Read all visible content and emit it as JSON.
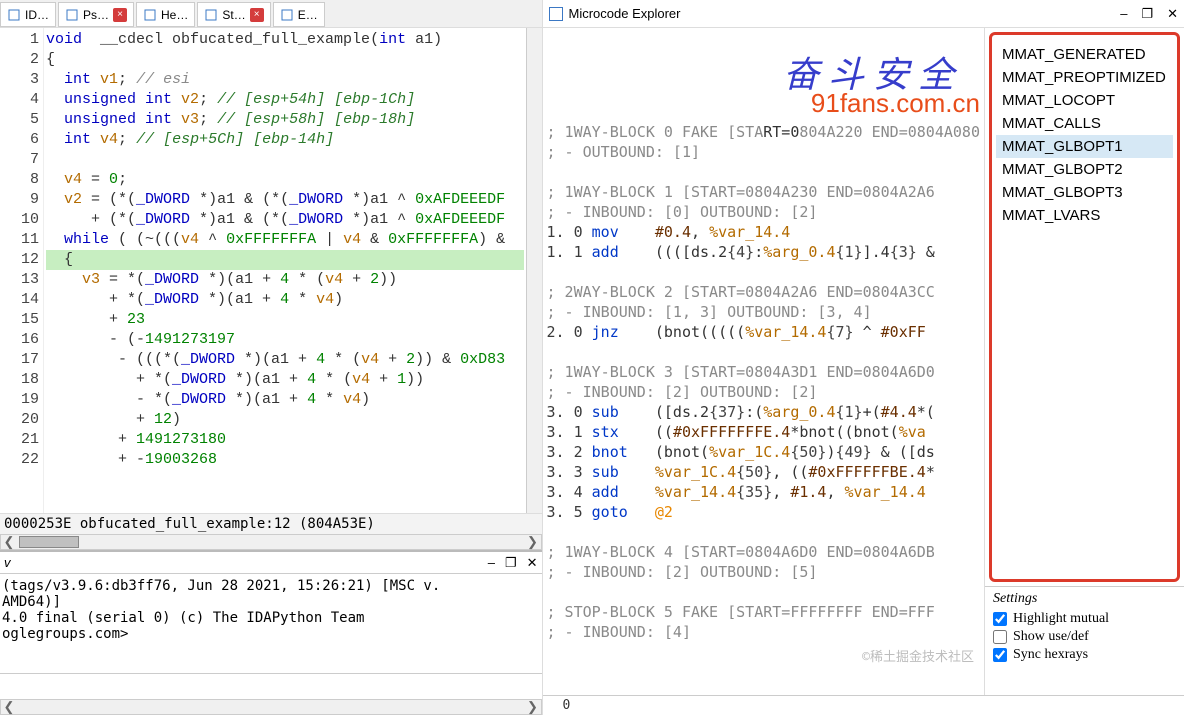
{
  "tabs": [
    {
      "icon": "doc",
      "label": "ID…"
    },
    {
      "icon": "doc",
      "label": "Ps…",
      "close": true
    },
    {
      "icon": "hex",
      "label": "He…"
    },
    {
      "icon": "struct",
      "label": "St…",
      "close": true
    },
    {
      "icon": "enum",
      "label": "E…"
    }
  ],
  "breakpoints": [
    8,
    9,
    10,
    11,
    13
  ],
  "code": [
    {
      "n": 1,
      "t": [
        [
          "kw",
          "void"
        ],
        [
          "op",
          "  __cdecl obfucated_full_example("
        ],
        [
          "kw",
          "int"
        ],
        [
          "op",
          " a1)"
        ]
      ]
    },
    {
      "n": 2,
      "t": [
        [
          "op",
          "{"
        ]
      ]
    },
    {
      "n": 3,
      "t": [
        [
          "op",
          "  "
        ],
        [
          "kw",
          "int"
        ],
        [
          "var",
          " v1"
        ],
        [
          "op",
          "; "
        ],
        [
          "cmt",
          "// esi"
        ]
      ]
    },
    {
      "n": 4,
      "t": [
        [
          "op",
          "  "
        ],
        [
          "kw",
          "unsigned int"
        ],
        [
          "var",
          " v2"
        ],
        [
          "op",
          "; "
        ],
        [
          "cmt-r",
          "// [esp+54h] [ebp-1Ch]"
        ]
      ]
    },
    {
      "n": 5,
      "t": [
        [
          "op",
          "  "
        ],
        [
          "kw",
          "unsigned int"
        ],
        [
          "var",
          " v3"
        ],
        [
          "op",
          "; "
        ],
        [
          "cmt-r",
          "// [esp+58h] [ebp-18h]"
        ]
      ]
    },
    {
      "n": 6,
      "t": [
        [
          "op",
          "  "
        ],
        [
          "kw",
          "int"
        ],
        [
          "var",
          " v4"
        ],
        [
          "op",
          "; "
        ],
        [
          "cmt-r",
          "// [esp+5Ch] [ebp-14h]"
        ]
      ]
    },
    {
      "n": 7,
      "t": []
    },
    {
      "n": 8,
      "t": [
        [
          "op",
          "  "
        ],
        [
          "var",
          "v4"
        ],
        [
          "op",
          " = "
        ],
        [
          "num",
          "0"
        ],
        [
          "op",
          ";"
        ]
      ]
    },
    {
      "n": 9,
      "t": [
        [
          "op",
          "  "
        ],
        [
          "var",
          "v2"
        ],
        [
          "op",
          " = (*("
        ],
        [
          "kw",
          "_DWORD"
        ],
        [
          "op",
          " *)a1 & (*("
        ],
        [
          "kw",
          "_DWORD"
        ],
        [
          "op",
          " *)a1 ^ "
        ],
        [
          "num",
          "0xAFDEEEDF"
        ]
      ]
    },
    {
      "n": 10,
      "t": [
        [
          "op",
          "     + (*("
        ],
        [
          "kw",
          "_DWORD"
        ],
        [
          "op",
          " *)a1 & (*("
        ],
        [
          "kw",
          "_DWORD"
        ],
        [
          "op",
          " *)a1 ^ "
        ],
        [
          "num",
          "0xAFDEEEDF"
        ]
      ]
    },
    {
      "n": 11,
      "t": [
        [
          "op",
          "  "
        ],
        [
          "kw",
          "while"
        ],
        [
          "op",
          " ( (~((("
        ],
        [
          "var",
          "v4"
        ],
        [
          "op",
          " ^ "
        ],
        [
          "num",
          "0xFFFFFFFA"
        ],
        [
          "op",
          " | "
        ],
        [
          "var",
          "v4"
        ],
        [
          "op",
          " & "
        ],
        [
          "num",
          "0xFFFFFFFA"
        ],
        [
          "op",
          ") &"
        ]
      ]
    },
    {
      "n": 12,
      "hl": true,
      "t": [
        [
          "op",
          "  {"
        ]
      ]
    },
    {
      "n": 13,
      "t": [
        [
          "op",
          "    "
        ],
        [
          "var",
          "v3"
        ],
        [
          "op",
          " = *("
        ],
        [
          "kw",
          "_DWORD"
        ],
        [
          "op",
          " *)(a1 + "
        ],
        [
          "num",
          "4"
        ],
        [
          "op",
          " * ("
        ],
        [
          "var",
          "v4"
        ],
        [
          "op",
          " + "
        ],
        [
          "num",
          "2"
        ],
        [
          "op",
          "))"
        ]
      ]
    },
    {
      "n": 14,
      "t": [
        [
          "op",
          "       + *("
        ],
        [
          "kw",
          "_DWORD"
        ],
        [
          "op",
          " *)(a1 + "
        ],
        [
          "num",
          "4"
        ],
        [
          "op",
          " * "
        ],
        [
          "var",
          "v4"
        ],
        [
          "op",
          ")"
        ]
      ]
    },
    {
      "n": 15,
      "t": [
        [
          "op",
          "       + "
        ],
        [
          "num",
          "23"
        ]
      ]
    },
    {
      "n": 16,
      "t": [
        [
          "op",
          "       - (-"
        ],
        [
          "num",
          "1491273197"
        ]
      ]
    },
    {
      "n": 17,
      "t": [
        [
          "op",
          "        - (((*("
        ],
        [
          "kw",
          "_DWORD"
        ],
        [
          "op",
          " *)(a1 + "
        ],
        [
          "num",
          "4"
        ],
        [
          "op",
          " * ("
        ],
        [
          "var",
          "v4"
        ],
        [
          "op",
          " + "
        ],
        [
          "num",
          "2"
        ],
        [
          "op",
          ")) & "
        ],
        [
          "num",
          "0xD83"
        ]
      ]
    },
    {
      "n": 18,
      "t": [
        [
          "op",
          "          + *("
        ],
        [
          "kw",
          "_DWORD"
        ],
        [
          "op",
          " *)(a1 + "
        ],
        [
          "num",
          "4"
        ],
        [
          "op",
          " * ("
        ],
        [
          "var",
          "v4"
        ],
        [
          "op",
          " + "
        ],
        [
          "num",
          "1"
        ],
        [
          "op",
          "))"
        ]
      ]
    },
    {
      "n": 19,
      "t": [
        [
          "op",
          "          - *("
        ],
        [
          "kw",
          "_DWORD"
        ],
        [
          "op",
          " *)(a1 + "
        ],
        [
          "num",
          "4"
        ],
        [
          "op",
          " * "
        ],
        [
          "var",
          "v4"
        ],
        [
          "op",
          ")"
        ]
      ]
    },
    {
      "n": 20,
      "t": [
        [
          "op",
          "          + "
        ],
        [
          "num",
          "12"
        ],
        [
          "op",
          ")"
        ]
      ]
    },
    {
      "n": 21,
      "t": [
        [
          "op",
          "        + "
        ],
        [
          "num",
          "1491273180"
        ]
      ]
    },
    {
      "n": 22,
      "t": [
        [
          "op",
          "        + -"
        ],
        [
          "num",
          "19003268"
        ]
      ]
    }
  ],
  "status_line": "0000253E obfucated_full_example:12 (804A53E)",
  "bottom_console": {
    "v": "v",
    "lines": [
      "(tags/v3.9.6:db3ff76, Jun 28 2021, 15:26:21) [MSC v.",
      "AMD64)]",
      "4.0 final (serial 0) (c) The IDAPython Team",
      "oglegroups.com>"
    ]
  },
  "mcx": {
    "title": "Microcode Explorer",
    "watermark1": "奋 斗 安 全",
    "watermark2": "91fans.com.cn",
    "faint_wm": "©稀土掘金技术社区",
    "lines": [
      [
        [
          "mcmt",
          "; 1WAY-BLOCK 0 FAKE [STA"
        ],
        [
          "mk",
          "RT=0"
        ],
        [
          "mcmt",
          "804A220 END=0804A080"
        ]
      ],
      [
        [
          "mcmt",
          "; - OUTBOUND: [1]"
        ]
      ],
      [
        [
          "mk",
          " "
        ]
      ],
      [
        [
          "mcmt",
          "; 1WAY-BLOCK 1 [START=0804A230 END=0804A2A6"
        ]
      ],
      [
        [
          "mcmt",
          "; - INBOUND: [0] OUTBOUND: [2]"
        ]
      ],
      [
        [
          "mdec",
          "1. 0 "
        ],
        [
          "mop",
          "mov"
        ],
        [
          "mk",
          "    "
        ],
        [
          "mnum",
          "#0.4"
        ],
        [
          "mk",
          ", "
        ],
        [
          "mvar",
          "%var_14.4"
        ]
      ],
      [
        [
          "mdec",
          "1. 1 "
        ],
        [
          "mop",
          "add"
        ],
        [
          "mk",
          "    ((([ds.2"
        ],
        [
          "mbrk",
          "{4}"
        ],
        [
          "mk",
          ":"
        ],
        [
          "mvar",
          "%arg_0.4"
        ],
        [
          "mbrk",
          "{1}"
        ],
        [
          "mk",
          "].4"
        ],
        [
          "mbrk",
          "{3}"
        ],
        [
          "mk",
          " &"
        ]
      ],
      [
        [
          "mk",
          " "
        ]
      ],
      [
        [
          "mcmt",
          "; 2WAY-BLOCK 2 [START=0804A2A6 END=0804A3CC"
        ]
      ],
      [
        [
          "mcmt",
          "; - INBOUND: [1, 3] OUTBOUND: [3, 4]"
        ]
      ],
      [
        [
          "mdec",
          "2. 0 "
        ],
        [
          "mop",
          "jnz"
        ],
        [
          "mk",
          "    (bnot((((("
        ],
        [
          "mvar",
          "%var_14.4"
        ],
        [
          "mbrk",
          "{7}"
        ],
        [
          "mk",
          " ^ "
        ],
        [
          "mnum",
          "#0xFF"
        ]
      ],
      [
        [
          "mk",
          " "
        ]
      ],
      [
        [
          "mcmt",
          "; 1WAY-BLOCK 3 [START=0804A3D1 END=0804A6D0"
        ]
      ],
      [
        [
          "mcmt",
          "; - INBOUND: [2] OUTBOUND: [2]"
        ]
      ],
      [
        [
          "mdec",
          "3. 0 "
        ],
        [
          "mop",
          "sub"
        ],
        [
          "mk",
          "    ([ds.2"
        ],
        [
          "mbrk",
          "{37}"
        ],
        [
          "mk",
          ":("
        ],
        [
          "mvar",
          "%arg_0.4"
        ],
        [
          "mbrk",
          "{1}"
        ],
        [
          "mk",
          "+("
        ],
        [
          "mnum",
          "#4.4"
        ],
        [
          "mk",
          "*("
        ]
      ],
      [
        [
          "mdec",
          "3. 1 "
        ],
        [
          "mop",
          "stx"
        ],
        [
          "mk",
          "    (("
        ],
        [
          "mnum",
          "#0xFFFFFFFE.4"
        ],
        [
          "mk",
          "*bnot((bnot("
        ],
        [
          "mvar",
          "%va"
        ]
      ],
      [
        [
          "mdec",
          "3. 2 "
        ],
        [
          "mop",
          "bnot"
        ],
        [
          "mk",
          "   (bnot("
        ],
        [
          "mvar",
          "%var_1C.4"
        ],
        [
          "mbrk",
          "{50}"
        ],
        [
          "mk",
          ")"
        ],
        [
          "mbrk",
          "{49}"
        ],
        [
          "mk",
          " & ([ds"
        ]
      ],
      [
        [
          "mdec",
          "3. 3 "
        ],
        [
          "mop",
          "sub"
        ],
        [
          "mk",
          "    "
        ],
        [
          "mvar",
          "%var_1C.4"
        ],
        [
          "mbrk",
          "{50}"
        ],
        [
          "mk",
          ", (("
        ],
        [
          "mnum",
          "#0xFFFFFFBE.4"
        ],
        [
          "mk",
          "*"
        ]
      ],
      [
        [
          "mdec",
          "3. 4 "
        ],
        [
          "mop",
          "add"
        ],
        [
          "mk",
          "    "
        ],
        [
          "mvar",
          "%var_14.4"
        ],
        [
          "mbrk",
          "{35}"
        ],
        [
          "mk",
          ", "
        ],
        [
          "mnum",
          "#1.4"
        ],
        [
          "mk",
          ", "
        ],
        [
          "mvar",
          "%var_14.4"
        ]
      ],
      [
        [
          "mdec",
          "3. 5 "
        ],
        [
          "mop",
          "goto"
        ],
        [
          "mk",
          "   "
        ],
        [
          "m-at",
          "@2"
        ]
      ],
      [
        [
          "mk",
          " "
        ]
      ],
      [
        [
          "mcmt",
          "; 1WAY-BLOCK 4 [START=0804A6D0 END=0804A6DB"
        ]
      ],
      [
        [
          "mcmt",
          "; - INBOUND: [2] OUTBOUND: [5]"
        ]
      ],
      [
        [
          "mk",
          " "
        ]
      ],
      [
        [
          "mcmt",
          "; STOP-BLOCK 5 FAKE [START=FFFFFFFF END=FFF"
        ]
      ],
      [
        [
          "mcmt",
          "; - INBOUND: [4]"
        ]
      ]
    ],
    "footer_val": "0",
    "mmat": {
      "items": [
        "MMAT_GENERATED",
        "MMAT_PREOPTIMIZED",
        "MMAT_LOCOPT",
        "MMAT_CALLS",
        "MMAT_GLBOPT1",
        "MMAT_GLBOPT2",
        "MMAT_GLBOPT3",
        "MMAT_LVARS"
      ],
      "selected": "MMAT_GLBOPT1"
    },
    "settings": {
      "header": "Settings",
      "highlight": {
        "label": "Highlight mutual",
        "checked": true
      },
      "usedef": {
        "label": "Show use/def",
        "checked": false
      },
      "sync": {
        "label": "Sync hexrays",
        "checked": true
      }
    }
  }
}
